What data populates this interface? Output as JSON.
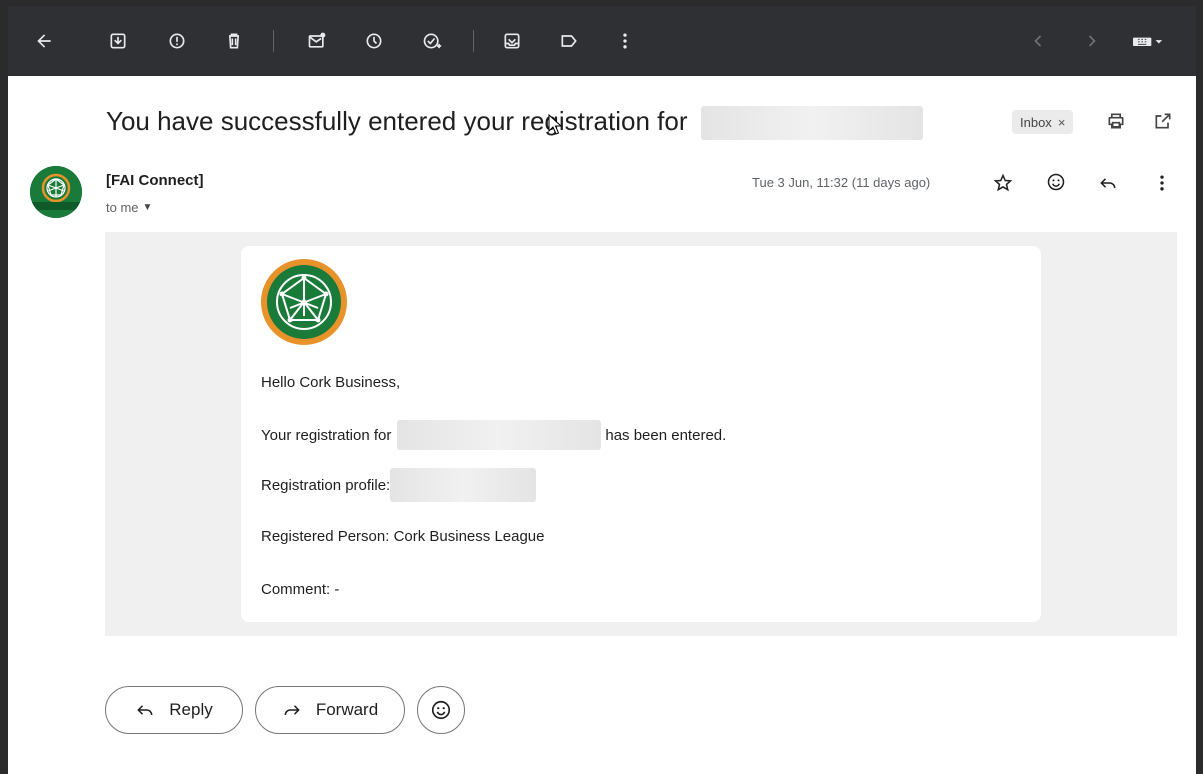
{
  "toolbar": {
    "icons": [
      "back-arrow-icon",
      "archive-icon",
      "report-spam-icon",
      "delete-icon",
      "mark-unread-icon",
      "snooze-icon",
      "add-to-tasks-icon",
      "move-to-icon",
      "label-icon",
      "more-vert-icon",
      "newer-icon",
      "older-icon",
      "keyboard-icon"
    ]
  },
  "email": {
    "subject": "You have successfully entered your registration for",
    "label": "Inbox",
    "label_close": "×",
    "sender": "[FAI Connect]",
    "to": "to me",
    "date": "Tue 3 Jun, 11:32 (11 days ago)"
  },
  "body": {
    "greeting": "Hello Cork Business,",
    "registration_prefix": "Your registration for",
    "registration_suffix": "has been entered.",
    "profile_label": "Registration profile:",
    "person": "Registered Person: Cork Business League",
    "comment": "Comment: -"
  },
  "actions": {
    "reply": "Reply",
    "forward": "Forward"
  },
  "colors": {
    "logo_green": "#1a7a3a",
    "logo_orange": "#e8922a",
    "toolbar_bg": "#2f3033"
  }
}
